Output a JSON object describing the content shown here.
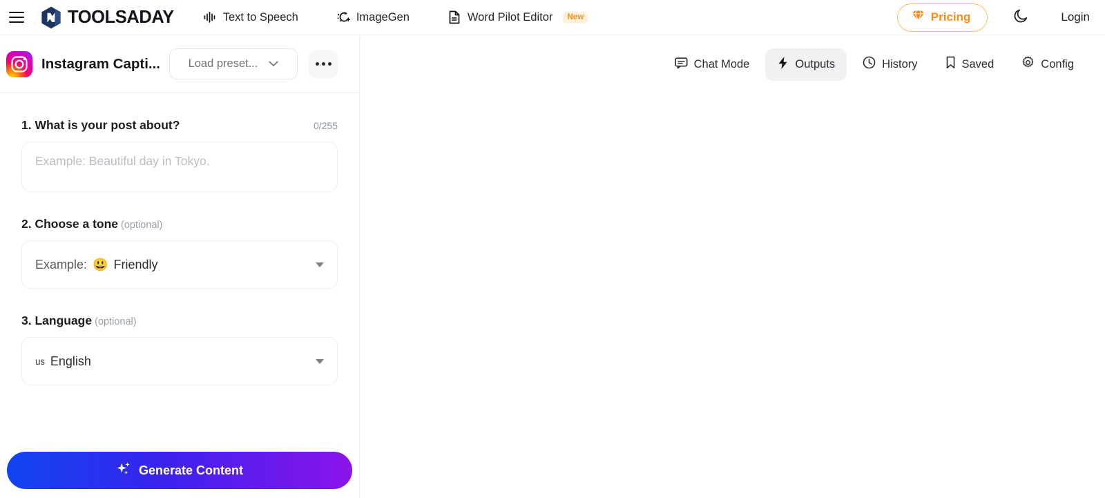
{
  "header": {
    "menu_icon": "hamburger-icon",
    "brand": "TOOLSADAY",
    "nav": [
      {
        "label": "Text to Speech",
        "icon": "waveform-icon",
        "badge": ""
      },
      {
        "label": "ImageGen",
        "icon": "sparkle-wand-icon",
        "badge": ""
      },
      {
        "label": "Word Pilot Editor",
        "icon": "document-icon",
        "badge": "New"
      }
    ],
    "pricing_label": "Pricing",
    "pricing_icon": "diamond-icon",
    "theme_icon": "moon-icon",
    "login_label": "Login",
    "accent_orange": "#fb8c16",
    "badge_bg": "#fdf0dd"
  },
  "sidebar": {
    "tool_icon": "instagram-icon",
    "tool_title": "Instagram Capti...",
    "preset_label": "Load preset...",
    "preset_caret": "chevron-down-icon",
    "more_label": "more-options",
    "fields": [
      {
        "label": "1. What is your post about?",
        "optional": "",
        "counter": "0/255",
        "placeholder": "Example: Beautiful day in Tokyo."
      },
      {
        "label": "2. Choose a tone",
        "optional": "(optional)",
        "value_prefix": "Example:",
        "value_emoji": "😃",
        "value": "Friendly"
      },
      {
        "label": "3. Language",
        "optional": "(optional)",
        "flag": "us",
        "value": "English"
      }
    ],
    "generate_label": "Generate Content",
    "generate_icon": "sparkles-icon"
  },
  "main": {
    "tabs": [
      {
        "label": "Chat Mode",
        "icon": "chat-bubble-icon",
        "active": false
      },
      {
        "label": "Outputs",
        "icon": "lightning-icon",
        "active": true
      },
      {
        "label": "History",
        "icon": "clock-icon",
        "active": false
      },
      {
        "label": "Saved",
        "icon": "bookmark-icon",
        "active": false
      },
      {
        "label": "Config",
        "icon": "gear-icon",
        "active": false
      }
    ]
  }
}
